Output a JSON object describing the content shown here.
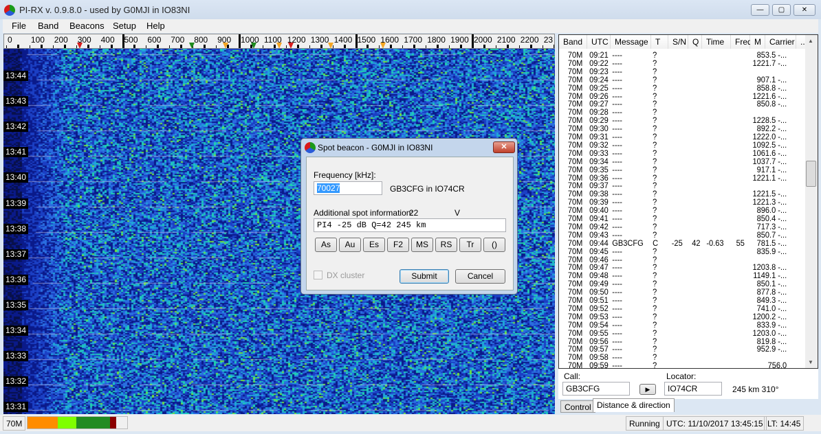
{
  "window": {
    "title": "PI-RX v. 0.9.8.0 - used by G0MJI in IO83NI"
  },
  "menu": [
    "File",
    "Band",
    "Beacons",
    "Setup",
    "Help"
  ],
  "scale": {
    "labels": [
      "0",
      "100",
      "200",
      "300",
      "400",
      "500",
      "600",
      "700",
      "800",
      "900",
      "1000",
      "1100",
      "1200",
      "1300",
      "1400",
      "1500",
      "1600",
      "1700",
      "1800",
      "1900",
      "2000",
      "2100",
      "2200",
      "23"
    ],
    "markers": [
      {
        "hz": 310,
        "color": "#d81e1e"
      },
      {
        "hz": 790,
        "color": "#1d8a1d"
      },
      {
        "hz": 935,
        "color": "#f5a623"
      },
      {
        "hz": 1055,
        "color": "#1d8a1d"
      },
      {
        "hz": 1165,
        "color": "#f5a623"
      },
      {
        "hz": 1215,
        "color": "#d81e1e"
      },
      {
        "hz": 1385,
        "color": "#f5a623"
      },
      {
        "hz": 1610,
        "color": "#f5a623"
      }
    ]
  },
  "waterfall": {
    "times": [
      "13:44",
      "13:43",
      "13:42",
      "13:41",
      "13:40",
      "13:39",
      "13:38",
      "13:37",
      "13:36",
      "13:35",
      "13:34",
      "13:33",
      "13:32",
      "13:31"
    ]
  },
  "table": {
    "headers": [
      "Band",
      "UTC",
      "Message",
      "T",
      "S/N",
      "Q",
      "Time",
      "Freq",
      "M",
      "Carrier",
      "..."
    ],
    "rows": [
      [
        "70M",
        "09:21",
        "----",
        "?",
        "",
        "",
        "",
        "",
        "",
        "853.5 -..."
      ],
      [
        "70M",
        "09:22",
        "----",
        "?",
        "",
        "",
        "",
        "",
        "",
        "1221.7 -..."
      ],
      [
        "70M",
        "09:23",
        "----",
        "?",
        "",
        "",
        "",
        "",
        "",
        ""
      ],
      [
        "70M",
        "09:24",
        "----",
        "?",
        "",
        "",
        "",
        "",
        "",
        "907.1 -..."
      ],
      [
        "70M",
        "09:25",
        "----",
        "?",
        "",
        "",
        "",
        "",
        "",
        "858.8 -..."
      ],
      [
        "70M",
        "09:26",
        "----",
        "?",
        "",
        "",
        "",
        "",
        "",
        "1221.6 -..."
      ],
      [
        "70M",
        "09:27",
        "----",
        "?",
        "",
        "",
        "",
        "",
        "",
        "850.8 -..."
      ],
      [
        "70M",
        "09:28",
        "----",
        "?",
        "",
        "",
        "",
        "",
        "",
        ""
      ],
      [
        "70M",
        "09:29",
        "----",
        "?",
        "",
        "",
        "",
        "",
        "",
        "1228.5 -..."
      ],
      [
        "70M",
        "09:30",
        "----",
        "?",
        "",
        "",
        "",
        "",
        "",
        "892.2 -..."
      ],
      [
        "70M",
        "09:31",
        "----",
        "?",
        "",
        "",
        "",
        "",
        "",
        "1222.0 -..."
      ],
      [
        "70M",
        "09:32",
        "----",
        "?",
        "",
        "",
        "",
        "",
        "",
        "1092.5 -..."
      ],
      [
        "70M",
        "09:33",
        "----",
        "?",
        "",
        "",
        "",
        "",
        "",
        "1061.6 -..."
      ],
      [
        "70M",
        "09:34",
        "----",
        "?",
        "",
        "",
        "",
        "",
        "",
        "1037.7 -..."
      ],
      [
        "70M",
        "09:35",
        "----",
        "?",
        "",
        "",
        "",
        "",
        "",
        "917.1 -..."
      ],
      [
        "70M",
        "09:36",
        "----",
        "?",
        "",
        "",
        "",
        "",
        "",
        "1221.1 -..."
      ],
      [
        "70M",
        "09:37",
        "----",
        "?",
        "",
        "",
        "",
        "",
        "",
        ""
      ],
      [
        "70M",
        "09:38",
        "----",
        "?",
        "",
        "",
        "",
        "",
        "",
        "1221.5 -..."
      ],
      [
        "70M",
        "09:39",
        "----",
        "?",
        "",
        "",
        "",
        "",
        "",
        "1221.3 -..."
      ],
      [
        "70M",
        "09:40",
        "----",
        "?",
        "",
        "",
        "",
        "",
        "",
        "896.0 -..."
      ],
      [
        "70M",
        "09:41",
        "----",
        "?",
        "",
        "",
        "",
        "",
        "",
        "850.4 -..."
      ],
      [
        "70M",
        "09:42",
        "----",
        "?",
        "",
        "",
        "",
        "",
        "",
        "717.3 -..."
      ],
      [
        "70M",
        "09:43",
        "----",
        "?",
        "",
        "",
        "",
        "",
        "",
        "850.7 -..."
      ],
      [
        "70M",
        "09:44",
        "GB3CFG",
        "C",
        "-25",
        "42",
        "-0.63",
        "55",
        "",
        "781.5 -..."
      ],
      [
        "70M",
        "09:45",
        "----",
        "?",
        "",
        "",
        "",
        "",
        "",
        "835.9 -..."
      ],
      [
        "70M",
        "09:46",
        "----",
        "?",
        "",
        "",
        "",
        "",
        "",
        ""
      ],
      [
        "70M",
        "09:47",
        "----",
        "?",
        "",
        "",
        "",
        "",
        "",
        "1203.8 -..."
      ],
      [
        "70M",
        "09:48",
        "----",
        "?",
        "",
        "",
        "",
        "",
        "",
        "1149.1 -..."
      ],
      [
        "70M",
        "09:49",
        "----",
        "?",
        "",
        "",
        "",
        "",
        "",
        "850.1 -..."
      ],
      [
        "70M",
        "09:50",
        "----",
        "?",
        "",
        "",
        "",
        "",
        "",
        "877.8 -..."
      ],
      [
        "70M",
        "09:51",
        "----",
        "?",
        "",
        "",
        "",
        "",
        "",
        "849.3 -..."
      ],
      [
        "70M",
        "09:52",
        "----",
        "?",
        "",
        "",
        "",
        "",
        "",
        "741.0 -..."
      ],
      [
        "70M",
        "09:53",
        "----",
        "?",
        "",
        "",
        "",
        "",
        "",
        "1200.2 -..."
      ],
      [
        "70M",
        "09:54",
        "----",
        "?",
        "",
        "",
        "",
        "",
        "",
        "833.9 -..."
      ],
      [
        "70M",
        "09:55",
        "----",
        "?",
        "",
        "",
        "",
        "",
        "",
        "1203.0 -..."
      ],
      [
        "70M",
        "09:56",
        "----",
        "?",
        "",
        "",
        "",
        "",
        "",
        "819.8 -..."
      ],
      [
        "70M",
        "09:57",
        "----",
        "?",
        "",
        "",
        "",
        "",
        "",
        "952.9 -..."
      ],
      [
        "70M",
        "09:58",
        "----",
        "?",
        "",
        "",
        "",
        "",
        "",
        ""
      ],
      [
        "70M",
        "09:59",
        "----",
        "?",
        "",
        "",
        "",
        "",
        "",
        "756.0"
      ]
    ]
  },
  "call": {
    "call_label": "Call:",
    "call_value": "GB3CFG",
    "locator_label": "Locator:",
    "locator_value": "IO74CR",
    "distance": "245 km 310°"
  },
  "tabs": [
    "Control",
    "Distance & direction"
  ],
  "status": {
    "band": "70M",
    "level_segments": [
      {
        "color": "#ff8c00",
        "pct": 30
      },
      {
        "color": "#7fff00",
        "pct": 19
      },
      {
        "color": "#228b22",
        "pct": 34
      },
      {
        "color": "#8b0000",
        "pct": 6
      }
    ],
    "state": "Running",
    "utc": "UTC: 11/10/2017 13:45:15",
    "lt": "LT: 14:45"
  },
  "dialog": {
    "title": "Spot beacon - G0MJI in IO83NI",
    "freq_label": "Frequency [kHz]:",
    "freq_value": "70027",
    "beacon": "GB3CFG in IO74CR",
    "add_label": "Additional spot information:",
    "add_count": "22",
    "add_flag": "V",
    "add_value": "PI4 -25 dB Q=42 245 km",
    "modes": [
      "As",
      "Au",
      "Es",
      "F2",
      "MS",
      "RS",
      "Tr",
      "()"
    ],
    "dx_cluster": "DX cluster",
    "submit": "Submit",
    "cancel": "Cancel",
    "close": "✕"
  }
}
